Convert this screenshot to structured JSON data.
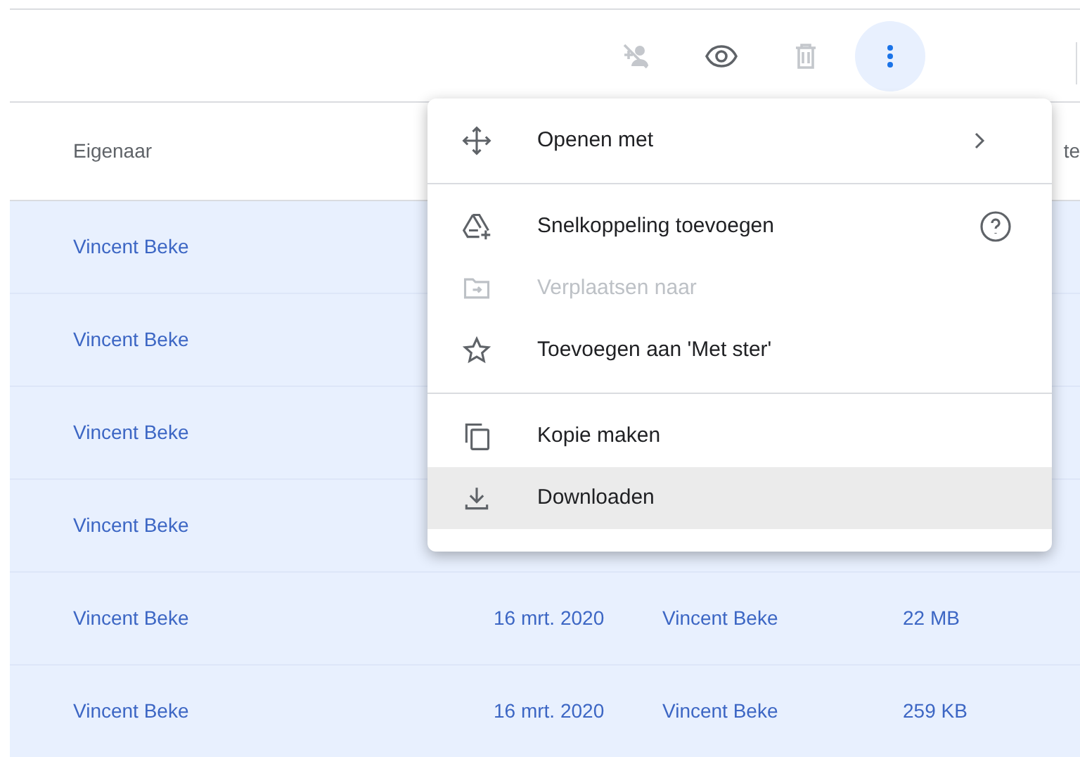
{
  "toolbar": [
    {
      "disabled": true
    },
    {
      "disabled": false
    },
    {
      "disabled": true
    },
    {
      "selected": true
    }
  ],
  "table": {
    "columns": [
      "Eigenaar",
      "te"
    ],
    "rows": [
      {
        "owner": "Vincent Beke"
      },
      {
        "owner": "Vincent Beke"
      },
      {
        "owner": "Vincent Beke"
      },
      {
        "owner": "Vincent Beke"
      },
      {
        "owner": "Vincent Beke",
        "date": "16 mrt. 2020",
        "modified_by": "Vincent Beke",
        "size": "22 MB"
      },
      {
        "owner": "Vincent Beke",
        "date": "16 mrt. 2020",
        "modified_by": "Vincent Beke",
        "size": "259 KB"
      }
    ]
  },
  "menu": {
    "sections": [
      [
        {
          "label": "Openen met",
          "disabled": false,
          "selected": false,
          "submenu": true
        }
      ],
      [
        {
          "label": "Snelkoppeling toevoegen",
          "disabled": false,
          "selected": false,
          "help": true
        },
        {
          "label": "Verplaatsen naar",
          "disabled": true,
          "selected": false
        },
        {
          "label": "Toevoegen aan 'Met ster'",
          "disabled": false,
          "selected": false
        }
      ],
      [
        {
          "label": "Kopie maken",
          "disabled": false,
          "selected": false
        },
        {
          "label": "Downloaden",
          "disabled": false,
          "selected": true
        }
      ]
    ]
  }
}
